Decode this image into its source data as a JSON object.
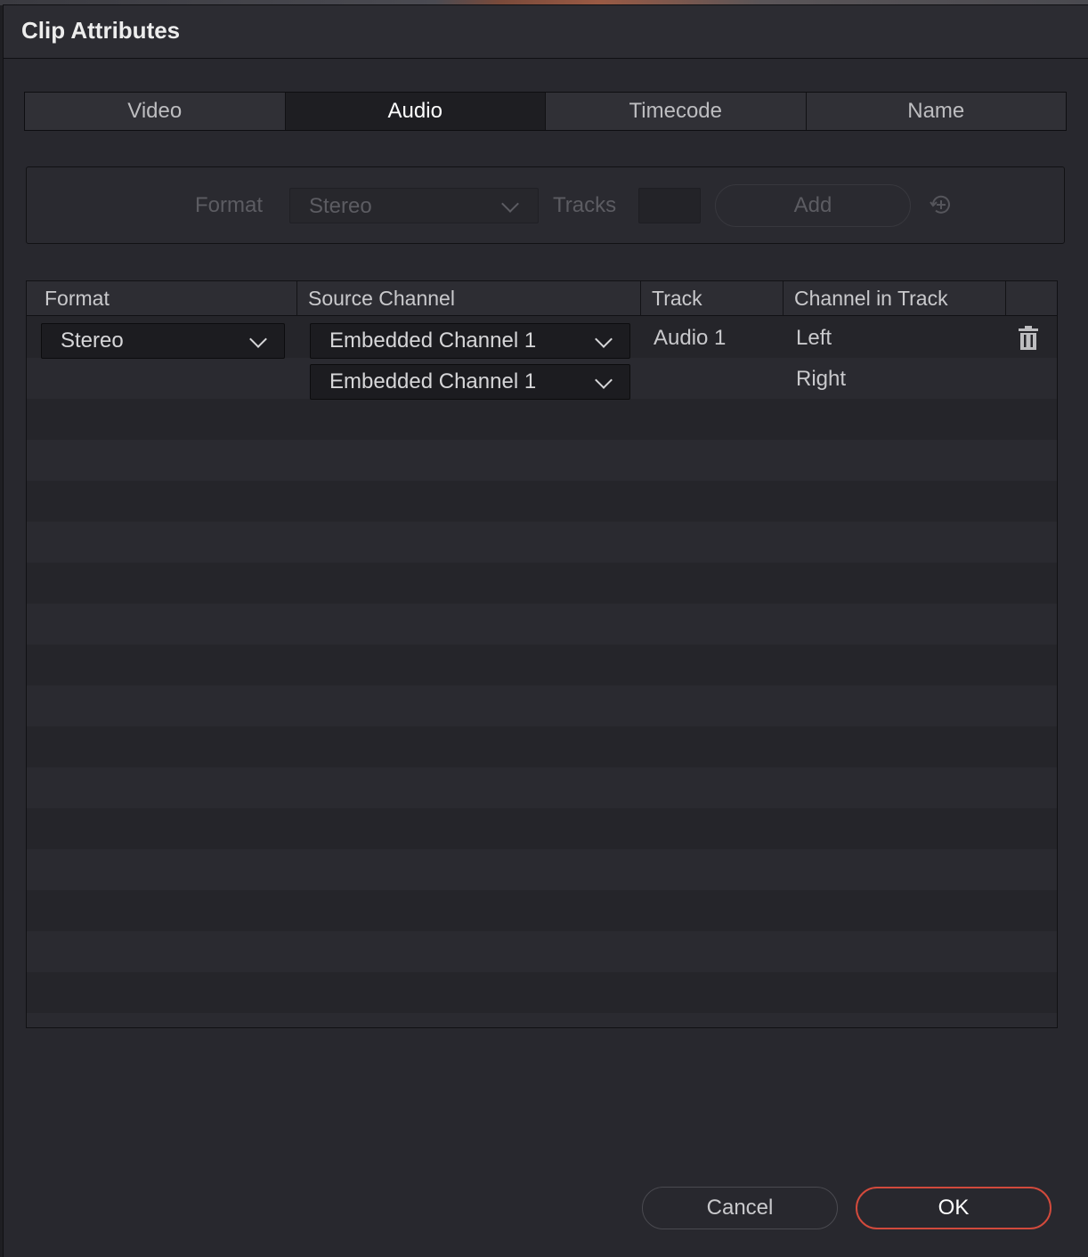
{
  "dialog": {
    "title": "Clip Attributes"
  },
  "tabs": [
    {
      "label": "Video"
    },
    {
      "label": "Audio",
      "active": true
    },
    {
      "label": "Timecode"
    },
    {
      "label": "Name"
    }
  ],
  "add_panel": {
    "format_label": "Format",
    "format_value": "Stereo",
    "tracks_label": "Tracks",
    "tracks_value": "",
    "add_label": "Add"
  },
  "grid": {
    "columns": [
      "Format",
      "Source Channel",
      "Track",
      "Channel in Track"
    ],
    "rows": [
      {
        "format": "Stereo",
        "source_channels": [
          "Embedded Channel 1",
          "Embedded Channel 1"
        ],
        "track": "Audio 1",
        "channels_in_track": [
          "Left",
          "Right"
        ]
      }
    ]
  },
  "footer": {
    "cancel_label": "Cancel",
    "ok_label": "OK"
  },
  "colors": {
    "accent": "#d24a3c",
    "background": "#28282e"
  }
}
